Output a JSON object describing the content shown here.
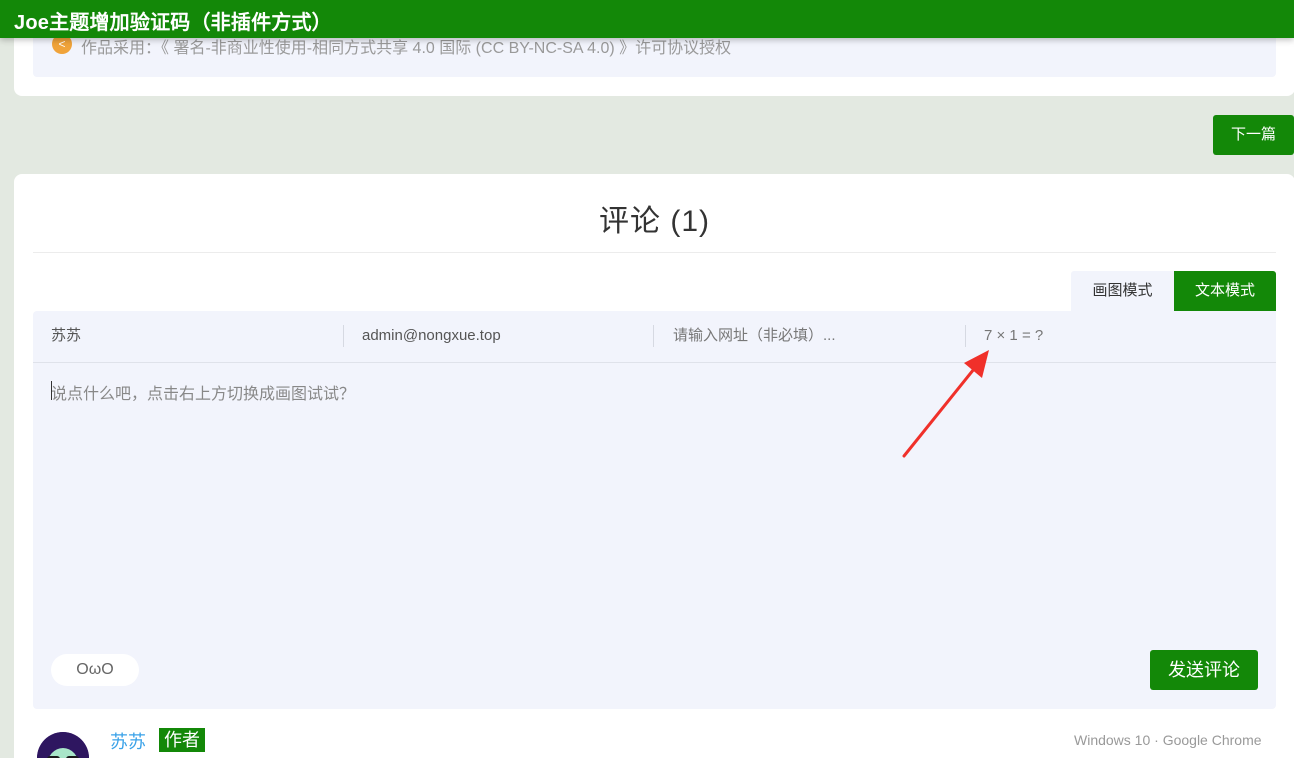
{
  "header": {
    "title": "Joe主题增加验证码（非插件方式）"
  },
  "post": {
    "license_icon": "share-icon",
    "license_text": "作品采用：《 署名-非商业性使用-相同方式共享 4.0 国际 (CC BY-NC-SA 4.0) 》许可协议授权"
  },
  "nav": {
    "next_label": "下一篇"
  },
  "comments": {
    "title": "评论 (1)",
    "tabs": {
      "draw": "画图模式",
      "text": "文本模式"
    },
    "form": {
      "nickname": "苏苏",
      "email": "admin@nongxue.top",
      "url_placeholder": "请输入网址（非必填）...",
      "captcha": "7 × 1 = ?",
      "content_placeholder": "说点什么吧，点击右上方切换成画图试试？",
      "owo_label": "OωO",
      "submit_label": "发送评论"
    },
    "first_comment": {
      "author": "苏苏",
      "badge": "作者",
      "user_agent": "Windows 10 · Google Chrome"
    }
  },
  "colors": {
    "brand": "#138808",
    "annotation_arrow": "#f0302a",
    "link": "#3aa2e8"
  }
}
